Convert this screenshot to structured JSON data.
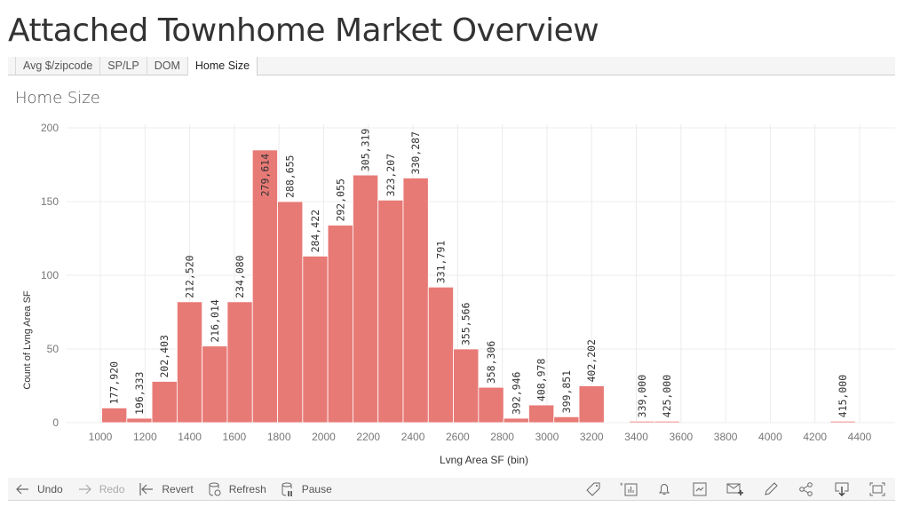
{
  "app": {
    "title": "Attached Townhome Market Overview"
  },
  "tabs": [
    {
      "label": "Avg $/zipcode",
      "active": false
    },
    {
      "label": "SP/LP",
      "active": false
    },
    {
      "label": "DOM",
      "active": false
    },
    {
      "label": "Home Size",
      "active": true
    }
  ],
  "sheet": {
    "title": "Home Size"
  },
  "colors": {
    "bar": "#E87A76",
    "grid": "#ececec",
    "axis_text": "#777777",
    "label_text": "#333333"
  },
  "chart_data": {
    "type": "bar",
    "title": "Home Size",
    "xlabel": "Lvng Area SF (bin)",
    "ylabel": "Count of Lvng Area SF",
    "ylim": [
      0,
      205
    ],
    "xlim": [
      890,
      4450
    ],
    "yticks": [
      0,
      50,
      100,
      150,
      200
    ],
    "xticks": [
      1000,
      1200,
      1400,
      1600,
      1800,
      2000,
      2200,
      2400,
      2600,
      2800,
      3000,
      3200,
      3400,
      3600,
      3800,
      4000,
      4200,
      4400
    ],
    "grid": true,
    "bin_size": 112.5,
    "bins": [
      {
        "bin_start": 1006,
        "count": 10,
        "label": "177,920"
      },
      {
        "bin_start": 1118.5,
        "count": 3,
        "label": "196,333"
      },
      {
        "bin_start": 1231,
        "count": 28,
        "label": "202,403"
      },
      {
        "bin_start": 1343.5,
        "count": 82,
        "label": "212,520"
      },
      {
        "bin_start": 1456,
        "count": 52,
        "label": "216,014"
      },
      {
        "bin_start": 1568.5,
        "count": 82,
        "label": "234,080"
      },
      {
        "bin_start": 1681,
        "count": 185,
        "label": "279,614"
      },
      {
        "bin_start": 1793.5,
        "count": 150,
        "label": "288,655"
      },
      {
        "bin_start": 1906,
        "count": 113,
        "label": "284,422"
      },
      {
        "bin_start": 2018.5,
        "count": 134,
        "label": "292,055"
      },
      {
        "bin_start": 2131,
        "count": 168,
        "label": "305,319"
      },
      {
        "bin_start": 2243.5,
        "count": 151,
        "label": "323,207"
      },
      {
        "bin_start": 2356,
        "count": 166,
        "label": "330,287"
      },
      {
        "bin_start": 2468.5,
        "count": 92,
        "label": "331,791"
      },
      {
        "bin_start": 2581,
        "count": 50,
        "label": "355,566"
      },
      {
        "bin_start": 2693.5,
        "count": 24,
        "label": "358,306"
      },
      {
        "bin_start": 2806,
        "count": 3,
        "label": "392,946"
      },
      {
        "bin_start": 2918.5,
        "count": 12,
        "label": "408,978"
      },
      {
        "bin_start": 3031,
        "count": 4,
        "label": "399,851"
      },
      {
        "bin_start": 3143.5,
        "count": 25,
        "label": "402,202"
      },
      {
        "bin_start": 3368.5,
        "count": 1,
        "label": "339,000"
      },
      {
        "bin_start": 3481,
        "count": 1,
        "label": "425,000"
      },
      {
        "bin_start": 4268.5,
        "count": 1,
        "label": "415,000"
      }
    ]
  },
  "toolbar": {
    "undo": "Undo",
    "redo": "Redo",
    "revert": "Revert",
    "refresh": "Refresh",
    "pause": "Pause",
    "right_icons": [
      "tag-icon",
      "data-source-icon",
      "alert-icon",
      "metrics-icon",
      "subscribe-icon",
      "edit-icon",
      "share-icon",
      "download-icon",
      "fullscreen-icon"
    ]
  }
}
